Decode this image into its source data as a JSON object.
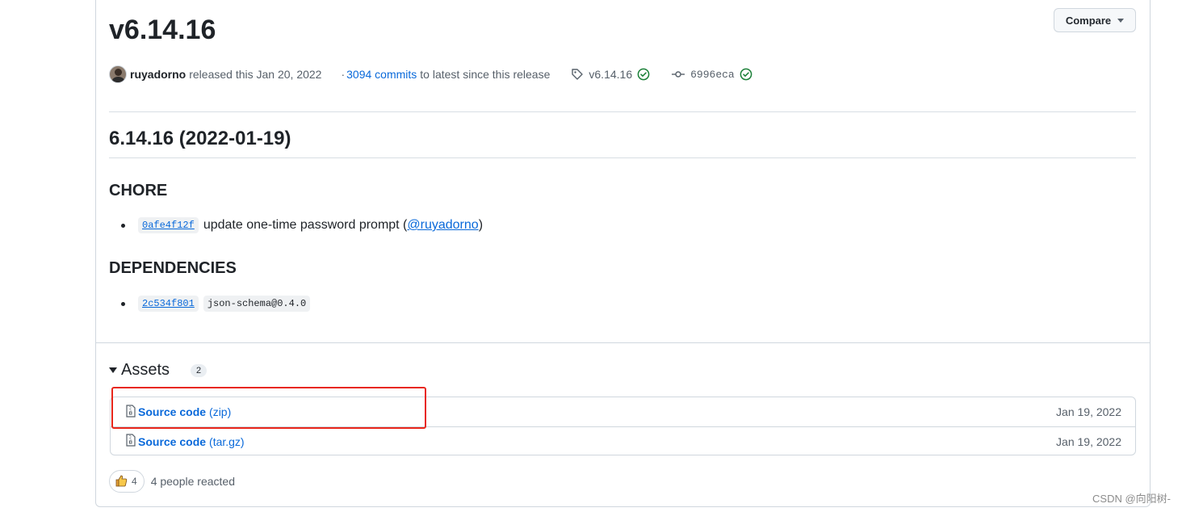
{
  "release": {
    "title": "v6.14.16",
    "compare_label": "Compare",
    "author": "ruyadorno",
    "released_text": "released this Jan 20, 2022",
    "commits_prefix": "·",
    "commits_link": "3094 commits",
    "commits_suffix": "to latest since this release",
    "tag": "v6.14.16",
    "commit_sha": "6996eca"
  },
  "notes": {
    "version_heading": "6.14.16 (2022-01-19)",
    "sections": [
      {
        "heading": "CHORE",
        "items": [
          {
            "sha": "0afe4f12f",
            "text": "update one-time password prompt (",
            "mention": "@ruyadorno",
            "close": ")"
          }
        ]
      },
      {
        "heading": "DEPENDENCIES",
        "items": [
          {
            "sha": "2c534f801",
            "code": "json-schema@0.4.0"
          }
        ]
      }
    ]
  },
  "assets": {
    "label": "Assets",
    "count": "2",
    "items": [
      {
        "name": "Source code",
        "ext": "(zip)",
        "date": "Jan 19, 2022"
      },
      {
        "name": "Source code",
        "ext": "(tar.gz)",
        "date": "Jan 19, 2022"
      }
    ]
  },
  "reactions": {
    "emoji": "thumbs-up-icon",
    "count": "4",
    "summary": "4 people reacted"
  },
  "watermark": "CSDN @向阳树-",
  "colors": {
    "link": "#0969da",
    "success": "#1a7f37",
    "highlight": "#e8271c"
  }
}
